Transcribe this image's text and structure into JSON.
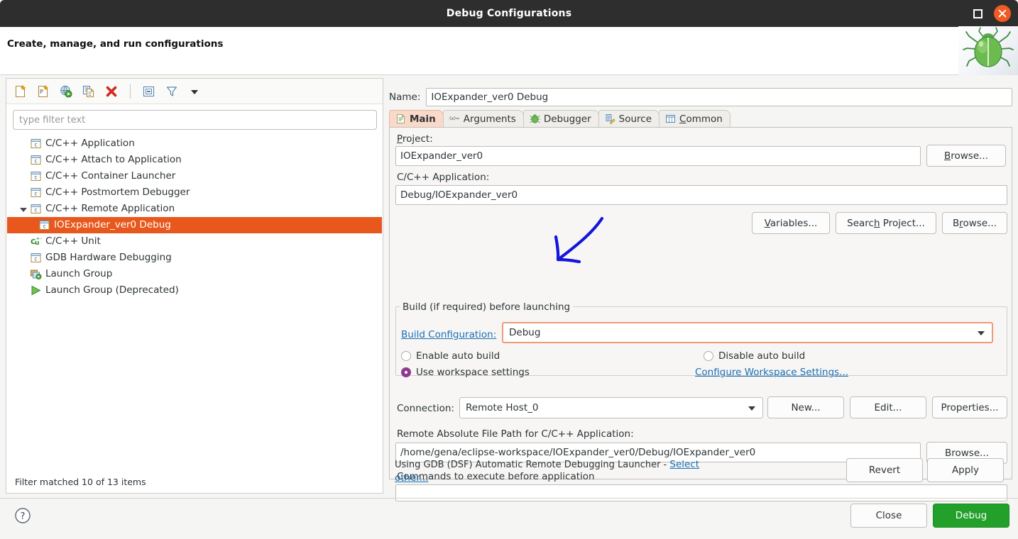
{
  "window": {
    "title": "Debug Configurations",
    "maximize_icon": "maximize-icon",
    "close_icon": "close-icon"
  },
  "header": {
    "heading": "Create, manage, and run configurations",
    "logo_icon": "green-bug-icon"
  },
  "toolbar": {
    "items": [
      {
        "icon": "new-launch-configuration-icon",
        "tooltip": "New launch configuration"
      },
      {
        "icon": "new-prototype-icon",
        "tooltip": "New prototype"
      },
      {
        "icon": "new-launch-group-icon",
        "tooltip": "New launch group"
      },
      {
        "icon": "duplicate-icon",
        "tooltip": "Duplicate"
      },
      {
        "icon": "delete-icon",
        "tooltip": "Delete"
      },
      {
        "icon": "collapse-all-icon",
        "tooltip": "Collapse All"
      },
      {
        "icon": "filter-icon",
        "tooltip": "Filter"
      },
      {
        "icon": "chevron-down-icon",
        "tooltip": "View menu"
      }
    ]
  },
  "filter": {
    "placeholder": "type filter text",
    "value": "",
    "status": "Filter matched 10 of 13 items"
  },
  "tree": {
    "items": [
      {
        "label": "C/C++ Application",
        "icon": "c-launch-icon",
        "indent": "parent",
        "selected": false,
        "twisty": "none"
      },
      {
        "label": "C/C++ Attach to Application",
        "icon": "c-launch-icon",
        "indent": "parent",
        "selected": false,
        "twisty": "none"
      },
      {
        "label": "C/C++ Container Launcher",
        "icon": "c-launch-icon",
        "indent": "parent",
        "selected": false,
        "twisty": "none"
      },
      {
        "label": "C/C++ Postmortem Debugger",
        "icon": "c-launch-icon",
        "indent": "parent",
        "selected": false,
        "twisty": "none"
      },
      {
        "label": "C/C++ Remote Application",
        "icon": "c-launch-icon",
        "indent": "parent",
        "selected": false,
        "twisty": "open"
      },
      {
        "label": "IOExpander_ver0 Debug",
        "icon": "c-launch-icon",
        "indent": "child",
        "selected": true,
        "twisty": "none"
      },
      {
        "label": "C/C++ Unit",
        "icon": "cunit-icon",
        "indent": "parent",
        "selected": false,
        "twisty": "none"
      },
      {
        "label": "GDB Hardware Debugging",
        "icon": "c-launch-icon",
        "indent": "parent",
        "selected": false,
        "twisty": "none"
      },
      {
        "label": "Launch Group",
        "icon": "launch-group-icon",
        "indent": "parent",
        "selected": false,
        "twisty": "none"
      },
      {
        "label": "Launch Group (Deprecated)",
        "icon": "launch-group-deprecated-icon",
        "indent": "parent",
        "selected": false,
        "twisty": "none"
      }
    ]
  },
  "config": {
    "name_label": "Name:",
    "name_value": "IOExpander_ver0 Debug",
    "tabs": [
      {
        "label": "Main",
        "icon": "document-icon",
        "active": true
      },
      {
        "label": "Arguments",
        "icon": "arguments-icon",
        "active": false
      },
      {
        "label": "Debugger",
        "icon": "bug-icon",
        "active": false
      },
      {
        "label": "Source",
        "icon": "source-icon",
        "active": false
      },
      {
        "label": "Common",
        "icon": "common-table-icon",
        "active": false,
        "mnemonic": "C"
      }
    ],
    "project_label": "Project:",
    "project_value": "IOExpander_ver0",
    "project_browse": "Browse...",
    "application_label": "C/C++ Application:",
    "application_value": "Debug/IOExpander_ver0",
    "variables_button": "Variables...",
    "search_project_button": "Search Project...",
    "app_browse_button": "Browse...",
    "build_group_title": "Build (if required) before launching",
    "build_config_link": "Build Configuration:",
    "build_config_value": "Debug",
    "radio_enable_auto_build": "Enable auto build",
    "radio_disable_auto_build": "Disable auto build",
    "radio_use_workspace_settings": "Use workspace settings",
    "radio_selected": "use_workspace_settings",
    "configure_workspace_link": "Configure Workspace Settings...",
    "connection_label": "Connection:",
    "connection_value": "Remote Host_0",
    "connection_new": "New...",
    "connection_edit": "Edit...",
    "connection_properties": "Properties...",
    "remote_path_label": "Remote Absolute File Path for C/C++ Application:",
    "remote_path_value": "/home/gena/eclipse-workspace/IOExpander_ver0/Debug/IOExpander_ver0",
    "remote_path_browse": "Browse...",
    "commands_label": "Commands to execute before application",
    "commands_value": ""
  },
  "launcher": {
    "text": "Using GDB (DSF) Automatic Remote Debugging Launcher - ",
    "link": "Select other..."
  },
  "footer": {
    "revert_button": "Revert",
    "apply_button": "Apply",
    "close_button": "Close",
    "debug_button": "Debug",
    "help_icon": "help-icon"
  },
  "annotation": {
    "type": "hand-drawn-arrow",
    "color": "#1414dc",
    "points_to": "build-configuration-combo"
  },
  "colors": {
    "selection_orange": "#e8581c",
    "active_tab": "#fbd9c9",
    "focus_border": "#ef9b7a",
    "link_blue": "#1a6fb5",
    "radio_purple": "#8e3a8e",
    "debug_green": "#22a02a",
    "close_red": "#f15a22",
    "titlebar": "#2e2e2e"
  }
}
